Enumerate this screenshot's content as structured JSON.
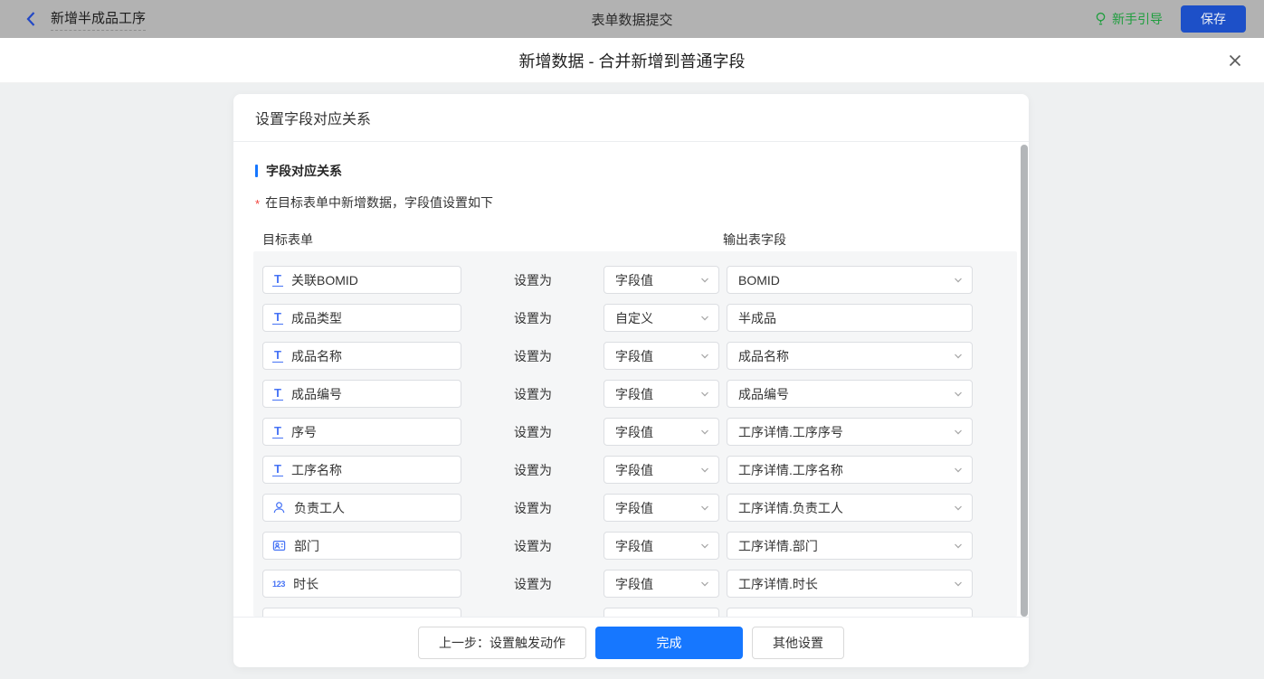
{
  "topbar": {
    "back_label": "新增半成品工序",
    "center_title": "表单数据提交",
    "guide_label": "新手引导",
    "save_label": "保存"
  },
  "dialog": {
    "title": "新增数据 - 合并新增到普通字段",
    "panel_title": "设置字段对应关系",
    "section_title": "字段对应关系",
    "note": "在目标表单中新增数据，字段值设置如下",
    "required_marker": "*",
    "col_left": "目标表单",
    "col_right": "输出表字段",
    "set_as_label": "设置为",
    "rows": [
      {
        "icon": "text-field-icon",
        "field": "关联BOMID",
        "mode": "字段值",
        "value": "BOMID",
        "value_type": "select"
      },
      {
        "icon": "text-field-icon",
        "field": "成品类型",
        "mode": "自定义",
        "value": "半成品",
        "value_type": "input"
      },
      {
        "icon": "text-field-icon",
        "field": "成品名称",
        "mode": "字段值",
        "value": "成品名称",
        "value_type": "select"
      },
      {
        "icon": "text-field-icon",
        "field": "成品编号",
        "mode": "字段值",
        "value": "成品编号",
        "value_type": "select"
      },
      {
        "icon": "text-field-icon",
        "field": "序号",
        "mode": "字段值",
        "value": "工序详情.工序序号",
        "value_type": "select"
      },
      {
        "icon": "text-field-icon",
        "field": "工序名称",
        "mode": "字段值",
        "value": "工序详情.工序名称",
        "value_type": "select"
      },
      {
        "icon": "member-icon",
        "field": "负责工人",
        "mode": "字段值",
        "value": "工序详情.负责工人",
        "value_type": "select"
      },
      {
        "icon": "department-icon",
        "field": "部门",
        "mode": "字段值",
        "value": "工序详情.部门",
        "value_type": "select"
      },
      {
        "icon": "number-icon",
        "field": "时长",
        "mode": "字段值",
        "value": "工序详情.时长",
        "value_type": "select"
      },
      {
        "icon": "",
        "field": "",
        "mode": "",
        "value": "",
        "value_type": "select",
        "partial": true
      }
    ],
    "footer": {
      "prev_label": "上一步：设置触发动作",
      "finish_label": "完成",
      "other_label": "其他设置"
    }
  },
  "colors": {
    "primary_blue": "#1677ff",
    "dimmed_save_blue": "#1d50c8",
    "guide_green": "#1f9e3e",
    "field_icon_blue": "#4673f5",
    "topbar_gray": "#b2b2b2",
    "required_red": "#f2413a"
  }
}
